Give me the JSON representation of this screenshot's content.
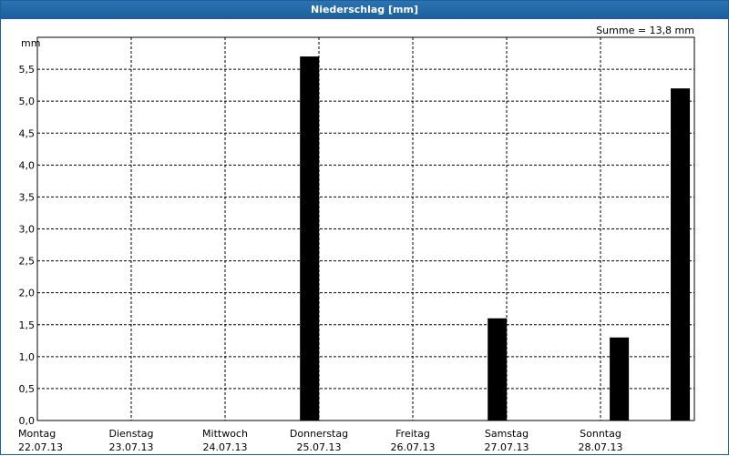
{
  "window": {
    "title": "Niederschlag [mm]"
  },
  "chart_data": {
    "type": "bar",
    "title": "Niederschlag [mm]",
    "ylabel": "mm",
    "ylim": [
      0,
      6
    ],
    "y_ticks": [
      "0,0",
      "0,5",
      "1,0",
      "1,5",
      "2,0",
      "2,5",
      "3,0",
      "3,5",
      "4,0",
      "4,5",
      "5,0",
      "5,5"
    ],
    "y_tick_values": [
      0,
      0.5,
      1,
      1.5,
      2,
      2.5,
      3,
      3.5,
      4,
      4.5,
      5,
      5.5
    ],
    "day_labels": [
      {
        "weekday": "Montag",
        "date": "22.07.13"
      },
      {
        "weekday": "Dienstag",
        "date": "23.07.13"
      },
      {
        "weekday": "Mittwoch",
        "date": "24.07.13"
      },
      {
        "weekday": "Donnerstag",
        "date": "25.07.13"
      },
      {
        "weekday": "Freitag",
        "date": "26.07.13"
      },
      {
        "weekday": "Samstag",
        "date": "27.07.13"
      },
      {
        "weekday": "Sonntag",
        "date": "28.07.13"
      }
    ],
    "x_range": [
      0,
      7
    ],
    "bars": [
      {
        "x": 2.9,
        "value": 5.7
      },
      {
        "x": 4.9,
        "value": 1.6
      },
      {
        "x": 6.2,
        "value": 1.3
      },
      {
        "x": 6.85,
        "value": 5.2
      }
    ],
    "annotation": "Summe = 13,8 mm",
    "grid": true,
    "colors": {
      "bar": "#000000",
      "title_bar": "#1f5f96"
    }
  }
}
